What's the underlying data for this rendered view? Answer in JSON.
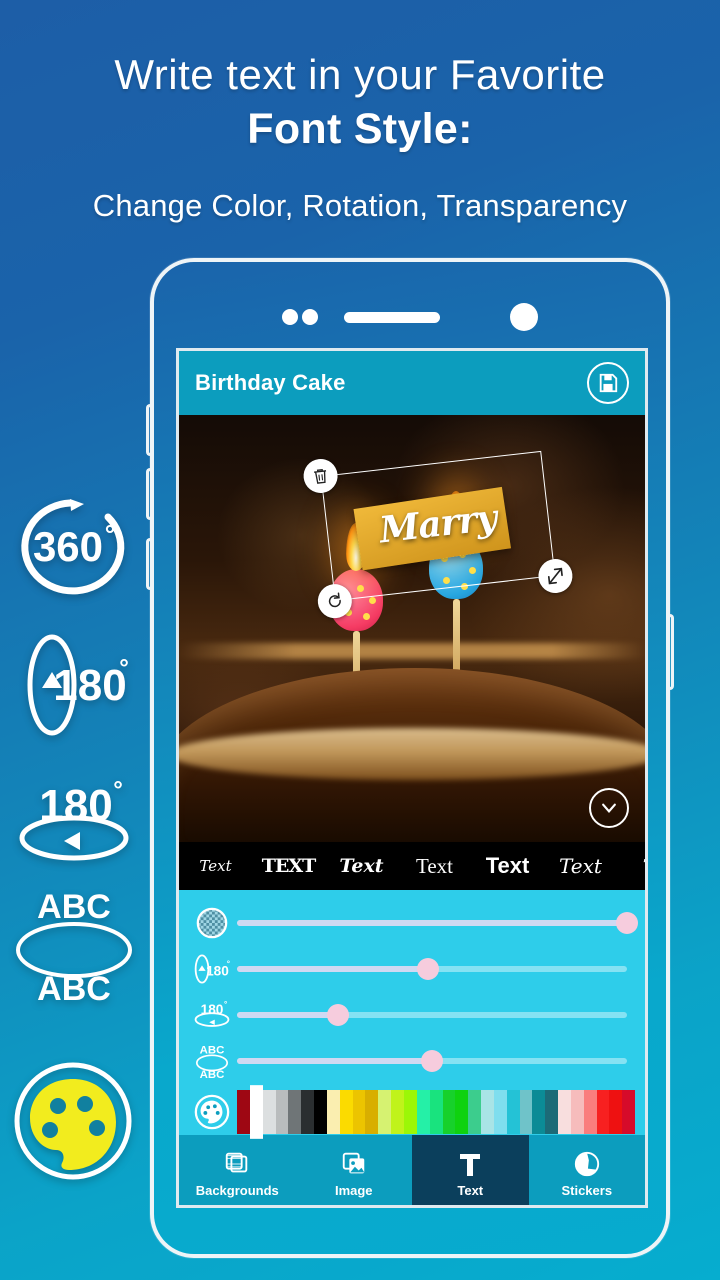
{
  "headline": {
    "line1": "Write text in your Favorite",
    "line2": "Font Style:",
    "line3": "Change Color, Rotation, Transparency"
  },
  "features": [
    {
      "name": "rotate-360",
      "label": "360°"
    },
    {
      "name": "flip-vertical-180",
      "label": "180°"
    },
    {
      "name": "flip-horizontal-180",
      "label": "180°"
    },
    {
      "name": "text-mirror-abc",
      "label_top": "ABC",
      "label_bottom": "ABC"
    },
    {
      "name": "color-palette",
      "label": ""
    }
  ],
  "app": {
    "title": "Birthday Cake",
    "save_icon": "save-floppy-icon",
    "overlay": {
      "text": "Marry",
      "delete_icon": "trash-icon",
      "rotate_icon": "rotate-icon",
      "resize_icon": "resize-diagonal-icon"
    },
    "expand_icon": "chevron-down-icon",
    "fonts": [
      {
        "label": "Text",
        "style": "fs0"
      },
      {
        "label": "TEXT",
        "style": "fs1"
      },
      {
        "label": "Text",
        "style": "fs2"
      },
      {
        "label": "Text",
        "style": "fs3"
      },
      {
        "label": "Text",
        "style": "fs4"
      },
      {
        "label": "Text",
        "style": "fs5"
      },
      {
        "label": "Te",
        "style": "fs6"
      }
    ],
    "sliders": [
      {
        "name": "transparency",
        "icon": "checker-circle-icon",
        "value": 100
      },
      {
        "name": "rotation-vertical",
        "icon": "flip-vertical-180-icon",
        "value": 49
      },
      {
        "name": "rotation-horizontal",
        "icon": "flip-horizontal-180-icon",
        "value": 26
      },
      {
        "name": "text-mirror",
        "icon": "abc-mirror-icon",
        "value": 50
      }
    ],
    "palette": {
      "icon": "palette-brush-icon",
      "selected_index": 1,
      "colors": [
        "#9e0713",
        "#ffffff",
        "#dcdfe0",
        "#b9bcbd",
        "#6f7577",
        "#2a2e30",
        "#000000",
        "#faeeb0",
        "#fbdb00",
        "#ecc400",
        "#d8ae00",
        "#d6f271",
        "#c0f31b",
        "#9cf707",
        "#25f0a7",
        "#19e37e",
        "#17d12b",
        "#0fd20f",
        "#3ccd8d",
        "#a9e4e6",
        "#7fdeee",
        "#24c2d6",
        "#6fc3c9",
        "#0b8b96",
        "#1c6a77",
        "#f8dede",
        "#f6bcbc",
        "#fa7d7d",
        "#f72020",
        "#ee1111",
        "#d60b2a"
      ]
    },
    "nav": [
      {
        "label": "Backgrounds",
        "icon": "backgrounds-icon",
        "active": false
      },
      {
        "label": "Image",
        "icon": "image-icon",
        "active": false
      },
      {
        "label": "Text",
        "icon": "text-t-icon",
        "active": true
      },
      {
        "label": "Stickers",
        "icon": "sticker-icon",
        "active": false
      }
    ]
  },
  "colors": {
    "brand_cyan": "#0c9dbe",
    "panel_cyan": "#2ecdea",
    "nav_active": "#0b3f5c",
    "accent_pink": "#f6ccdd",
    "palette_yellow": "#f2ec1e"
  }
}
